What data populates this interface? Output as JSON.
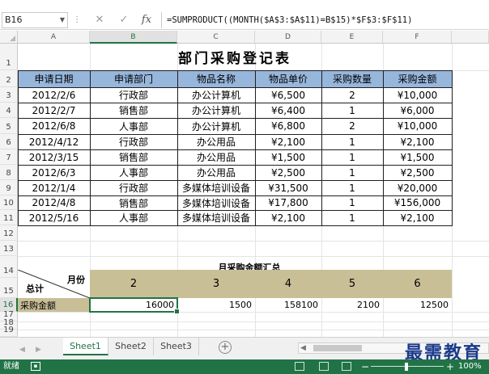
{
  "formula_bar": {
    "name_box": "B16",
    "formula": "=SUMPRODUCT((MONTH($A$3:$A$11)=B$15)*$F$3:$F$11)",
    "fx_label": "fx"
  },
  "columns": [
    "A",
    "B",
    "C",
    "D",
    "E",
    "F"
  ],
  "rows": [
    "1",
    "2",
    "3",
    "4",
    "5",
    "6",
    "7",
    "8",
    "9",
    "10",
    "11",
    "12",
    "13",
    "14",
    "15",
    "16",
    "17",
    "18",
    "19"
  ],
  "title": "部门采购登记表",
  "table_headers": [
    "申请日期",
    "申请部门",
    "物品名称",
    "物品单价",
    "采购数量",
    "采购金额"
  ],
  "table_rows": [
    [
      "2012/2/6",
      "行政部",
      "办公计算机",
      "¥6,500",
      "2",
      "¥10,000"
    ],
    [
      "2012/2/7",
      "销售部",
      "办公计算机",
      "¥6,400",
      "1",
      "¥6,000"
    ],
    [
      "2012/6/8",
      "人事部",
      "办公计算机",
      "¥6,800",
      "2",
      "¥10,000"
    ],
    [
      "2012/4/12",
      "行政部",
      "办公用品",
      "¥2,100",
      "1",
      "¥2,100"
    ],
    [
      "2012/3/15",
      "销售部",
      "办公用品",
      "¥1,500",
      "1",
      "¥1,500"
    ],
    [
      "2012/6/3",
      "人事部",
      "办公用品",
      "¥2,500",
      "1",
      "¥2,500"
    ],
    [
      "2012/1/4",
      "行政部",
      "多媒体培训设备",
      "¥31,500",
      "1",
      "¥20,000"
    ],
    [
      "2012/4/8",
      "销售部",
      "多媒体培训设备",
      "¥17,800",
      "1",
      "¥156,000"
    ],
    [
      "2012/5/16",
      "人事部",
      "多媒体培训设备",
      "¥2,100",
      "1",
      "¥2,100"
    ]
  ],
  "summary": {
    "title": "月采购金额汇总",
    "corner_month": "月份",
    "corner_total": "总计",
    "months": [
      "2",
      "3",
      "4",
      "5",
      "6"
    ],
    "row_label": "采购金额",
    "values": [
      "16000",
      "1500",
      "158100",
      "2100",
      "12500"
    ]
  },
  "sheets": [
    "Sheet1",
    "Sheet2",
    "Sheet3"
  ],
  "active_sheet": "Sheet1",
  "watermark": "最需教育",
  "status": {
    "ready": "就绪",
    "zoom": "100%"
  }
}
